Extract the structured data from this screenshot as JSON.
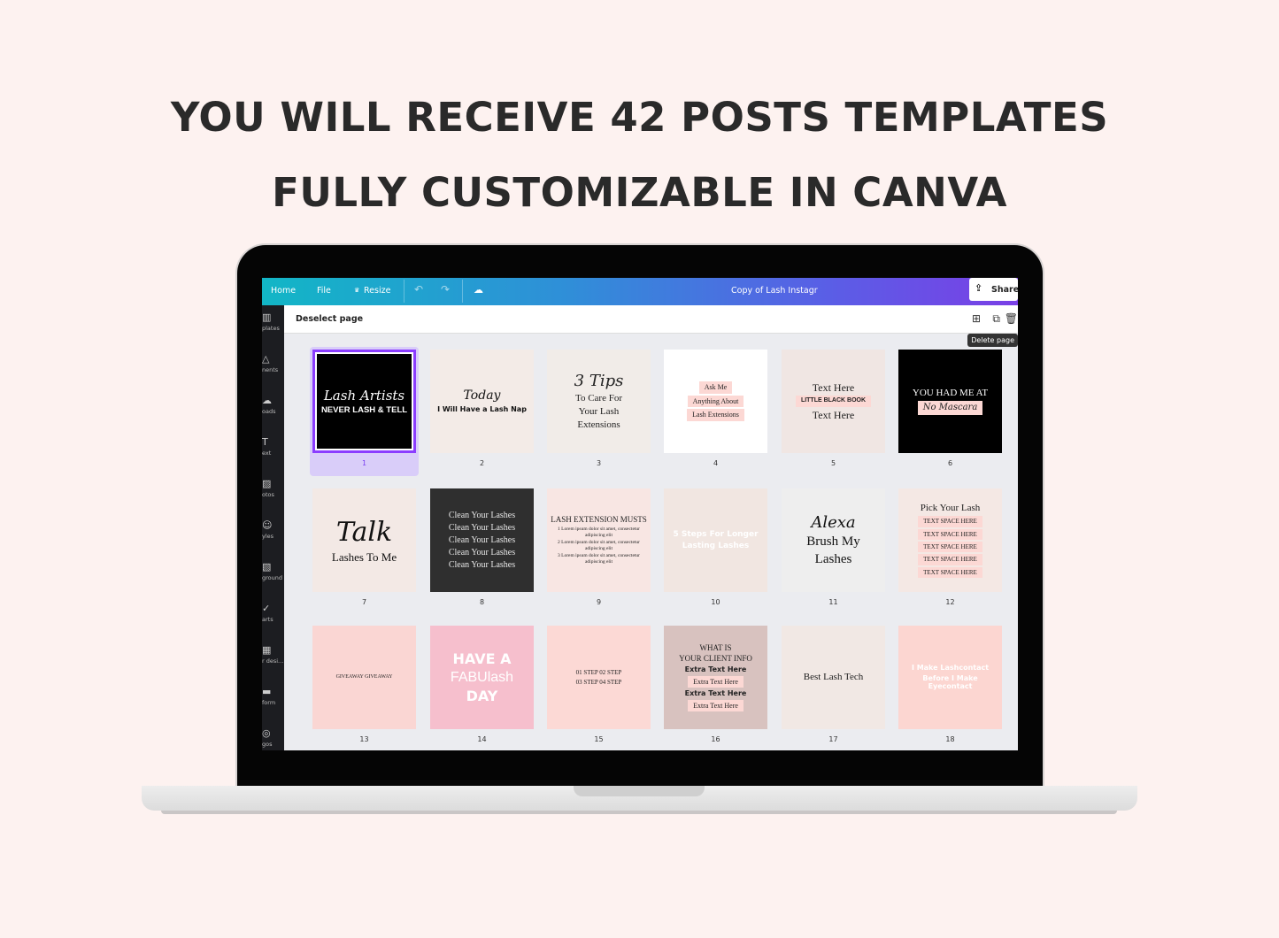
{
  "headline": {
    "line1": "YOU WILL RECEIVE 42 POSTS TEMPLATES",
    "line2": "FULLY CUSTOMIZABLE IN CANVA"
  },
  "colors": {
    "background": "#fdf2f0",
    "topbar_start": "#12b6c6",
    "topbar_end": "#7a3fe6",
    "selection": "#8b3dff",
    "canvas": "#ebecf0"
  },
  "topbar": {
    "home": "Home",
    "file": "File",
    "resize_icon": "crown-icon",
    "resize": "Resize",
    "undo_icon": "undo-icon",
    "redo_icon": "redo-icon",
    "cloud_icon": "cloud-check-icon",
    "title": "Copy of Lash Instagr",
    "share": "Share",
    "share_icon": "upload-icon"
  },
  "subbar": {
    "deselect": "Deselect page",
    "tooltip": "Delete page",
    "icons": [
      "add-page-icon",
      "duplicate-page-icon",
      "trash-icon"
    ]
  },
  "sidebar": {
    "items": [
      {
        "icon": "▥",
        "label": "plates"
      },
      {
        "icon": "△",
        "label": "nents"
      },
      {
        "icon": "☁",
        "label": "oads"
      },
      {
        "icon": "T",
        "label": "ext"
      },
      {
        "icon": "▨",
        "label": "otos"
      },
      {
        "icon": "☺",
        "label": "yles"
      },
      {
        "icon": "▧",
        "label": "ground"
      },
      {
        "icon": "✓",
        "label": "arts"
      },
      {
        "icon": "▦",
        "label": "r desi..."
      },
      {
        "icon": "▬",
        "label": "form"
      },
      {
        "icon": "◎",
        "label": "gos"
      }
    ]
  },
  "pages": [
    {
      "number": "1",
      "selected": true,
      "bg": "#000000",
      "color": "#ffffff",
      "texts": [
        {
          "t": "Lash Artists",
          "c": "script",
          "s": 15
        },
        {
          "t": "NEVER LASH & TELL",
          "c": "t-sans b",
          "s": 9.5
        }
      ]
    },
    {
      "number": "2",
      "bg": "#f3ebe7",
      "color": "#111",
      "texts": [
        {
          "t": "Today",
          "c": "script",
          "s": 14
        },
        {
          "t": "I Will Have a Lash Nap",
          "c": "t-serif blackbar",
          "s": 8
        }
      ]
    },
    {
      "number": "3",
      "bg": "#f1ece8",
      "color": "#222",
      "texts": [
        {
          "t": "3 Tips",
          "c": "script",
          "s": 18
        },
        {
          "t": "To Care For",
          "c": "t-serif",
          "s": 11
        },
        {
          "t": "Your Lash",
          "c": "t-serif",
          "s": 11
        },
        {
          "t": "Extensions",
          "c": "t-serif",
          "s": 11
        }
      ]
    },
    {
      "number": "4",
      "bg": "#ffffff",
      "color": "#222",
      "texts": [
        {
          "t": "Ask Me",
          "c": "t-serif pinkbar",
          "s": 8
        },
        {
          "t": "Anything About",
          "c": "t-serif pinkbar",
          "s": 8
        },
        {
          "t": "Lash Extensions",
          "c": "t-serif pinkbar",
          "s": 8
        }
      ]
    },
    {
      "number": "5",
      "bg": "#f0e6e3",
      "color": "#222",
      "texts": [
        {
          "t": "Text Here",
          "c": "t-serif",
          "s": 12
        },
        {
          "t": "LITTLE BLACK BOOK",
          "c": "t-sans b pinkbar",
          "s": 7
        },
        {
          "t": "Text Here",
          "c": "t-serif",
          "s": 12
        }
      ]
    },
    {
      "number": "6",
      "bg": "#000000",
      "color": "#ffffff",
      "texts": [
        {
          "t": "YOU HAD ME AT",
          "c": "t-serif",
          "s": 11
        },
        {
          "t": "No Mascara",
          "c": "script pinkbar",
          "s": 10
        }
      ]
    },
    {
      "number": "7",
      "bg": "#f3e9e5",
      "color": "#111",
      "texts": [
        {
          "t": "Talk",
          "c": "script",
          "s": 30
        },
        {
          "t": "Lashes To Me",
          "c": "t-serif",
          "s": 13
        }
      ]
    },
    {
      "number": "8",
      "bg": "#2f2f2f",
      "color": "#e8e8e8",
      "texts": [
        {
          "t": "Clean Your Lashes",
          "c": "t-serif",
          "s": 10
        },
        {
          "t": "Clean Your Lashes",
          "c": "t-serif",
          "s": 10
        },
        {
          "t": "Clean Your Lashes",
          "c": "t-serif",
          "s": 10
        },
        {
          "t": "Clean Your Lashes",
          "c": "t-serif",
          "s": 10
        },
        {
          "t": "Clean Your Lashes",
          "c": "t-serif",
          "s": 10
        }
      ]
    },
    {
      "number": "9",
      "bg": "#f8e6e3",
      "color": "#222",
      "texts": [
        {
          "t": "LASH EXTENSION MUSTS",
          "c": "t-serif",
          "s": 9
        },
        {
          "t": "1  Lorem ipsum dolor sit amet, consectetur adipiscing elit",
          "c": "t-serif",
          "s": 5.5
        },
        {
          "t": "2  Lorem ipsum dolor sit amet, consectetur adipiscing elit",
          "c": "t-serif",
          "s": 5.5
        },
        {
          "t": "3  Lorem ipsum dolor sit amet, consectetur adipiscing elit",
          "c": "t-serif",
          "s": 5.5
        }
      ]
    },
    {
      "number": "10",
      "bg": "#f1e6e1",
      "color": "#fff",
      "texts": [
        {
          "t": "5 Steps For Longer",
          "c": "t-sans blackbar",
          "s": 9
        },
        {
          "t": "Lasting Lashes",
          "c": "t-serif blackbar",
          "s": 9
        }
      ]
    },
    {
      "number": "11",
      "bg": "#eeeeee",
      "color": "#111",
      "texts": [
        {
          "t": "Alexa",
          "c": "script",
          "s": 18
        },
        {
          "t": "Brush My",
          "c": "t-serif",
          "s": 15
        },
        {
          "t": "Lashes",
          "c": "t-serif",
          "s": 15
        }
      ]
    },
    {
      "number": "12",
      "bg": "#f4e8e4",
      "color": "#222",
      "texts": [
        {
          "t": "Pick Your Lash",
          "c": "t-serif",
          "s": 11
        },
        {
          "t": "TEXT SPACE HERE",
          "c": "t-serif pinkbar",
          "s": 7
        },
        {
          "t": "TEXT SPACE HERE",
          "c": "t-serif pinkbar",
          "s": 7
        },
        {
          "t": "TEXT SPACE HERE",
          "c": "t-serif pinkbar",
          "s": 7
        },
        {
          "t": "TEXT SPACE HERE",
          "c": "t-serif pinkbar",
          "s": 7
        },
        {
          "t": "TEXT SPACE HERE",
          "c": "t-serif pinkbar",
          "s": 7
        }
      ]
    },
    {
      "number": "13",
      "bg": "#fad6d3",
      "color": "#222",
      "texts": [
        {
          "t": "GIVEAWAY GIVEAWAY",
          "c": "t-serif",
          "s": 6
        }
      ]
    },
    {
      "number": "14",
      "bg": "#f6bfcd",
      "color": "#fff",
      "texts": [
        {
          "t": "HAVE A",
          "c": "t-sans blackbar",
          "s": 16
        },
        {
          "t": "FABUlash",
          "c": "t-sans",
          "s": 16
        },
        {
          "t": "DAY",
          "c": "t-sans blackbar",
          "s": 16
        }
      ]
    },
    {
      "number": "15",
      "bg": "#fcd9d5",
      "color": "#222",
      "texts": [
        {
          "t": "01 STEP   02 STEP",
          "c": "t-serif",
          "s": 7
        },
        {
          "t": "03 STEP   04 STEP",
          "c": "t-serif",
          "s": 7
        }
      ]
    },
    {
      "number": "16",
      "bg": "#d8c2bf",
      "color": "#222",
      "texts": [
        {
          "t": "WHAT IS",
          "c": "t-serif",
          "s": 9
        },
        {
          "t": "YOUR CLIENT INFO",
          "c": "t-serif",
          "s": 9
        },
        {
          "t": "Extra Text Here",
          "c": "t-serif blackbar",
          "s": 8
        },
        {
          "t": "Extra Text Here",
          "c": "t-serif pinkbar",
          "s": 8
        },
        {
          "t": "Extra Text Here",
          "c": "t-sans blackbar",
          "s": 8
        },
        {
          "t": "Extra Text Here",
          "c": "t-serif pinkbar",
          "s": 8
        }
      ]
    },
    {
      "number": "17",
      "bg": "#f1e8e4",
      "color": "#222",
      "texts": [
        {
          "t": "Best Lash Tech",
          "c": "t-serif",
          "s": 11
        }
      ]
    },
    {
      "number": "18",
      "bg": "#fcd6d1",
      "color": "#fff",
      "texts": [
        {
          "t": "I Make Lashcontact",
          "c": "t-serif blackbar",
          "s": 8
        },
        {
          "t": "Before I Make Eyecontact",
          "c": "t-serif blackbar",
          "s": 8
        }
      ]
    }
  ]
}
